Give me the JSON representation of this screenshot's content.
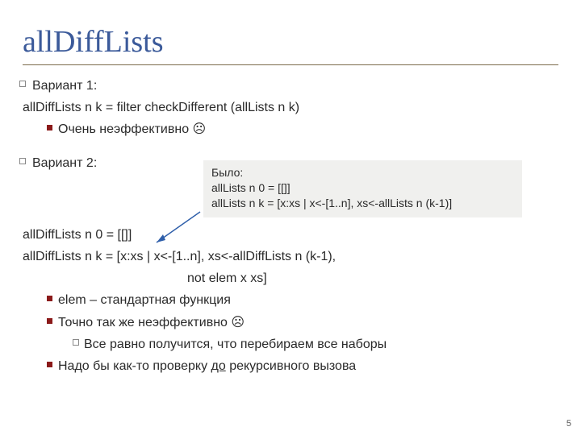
{
  "title": "allDiffLists",
  "page_number": "5",
  "body": {
    "variant1_label": "Вариант 1:",
    "variant1_code": "allDiffLists n k = filter checkDifferent (allLists n k)",
    "variant1_note": "Очень неэффективно ☹",
    "variant2_label": "Вариант 2:",
    "def_line1": "allDiffLists n 0 = [[]]",
    "def_line2a": "allDiffLists n k = [x:xs | x<-[1..n], xs<-allDiffLists n (k-1),",
    "def_line2b": "not elem x xs]",
    "note_elem": "elem – стандартная функция",
    "note_ineff": "Точно так же неэффективно ☹",
    "note_all_enum": "Все равно получится, что перебираем все наборы",
    "note_check_prefix": "Надо бы как-то проверку ",
    "note_check_underlined": "до",
    "note_check_suffix": " рекурсивного вызова"
  },
  "callout": {
    "line1": "Было:",
    "line2": "allLists n 0 = [[]]",
    "line3": "allLists n k = [x:xs | x<-[1..n], xs<-allLists n (k-1)]"
  }
}
